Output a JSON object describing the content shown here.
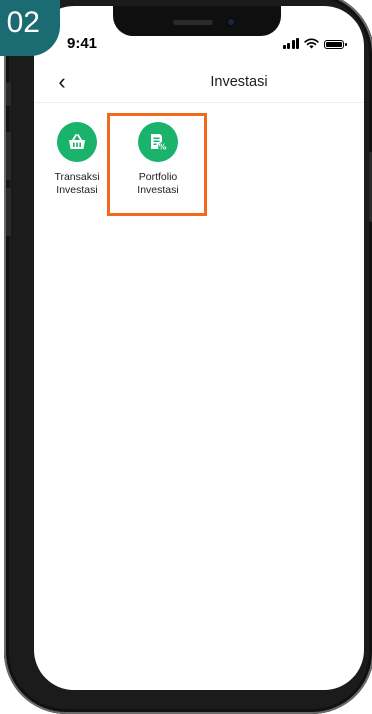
{
  "step_badge": "02",
  "status_bar": {
    "time": "9:41"
  },
  "header": {
    "back_glyph": "‹",
    "title": "Investasi"
  },
  "menu": [
    {
      "label_line1": "Transaksi",
      "label_line2": "Investasi",
      "icon": "shopping-basket-icon",
      "highlighted": false
    },
    {
      "label_line1": "Portfolio",
      "label_line2": "Investasi",
      "icon": "document-percent-icon",
      "highlighted": true
    }
  ],
  "colors": {
    "accent_green": "#1ab36b",
    "highlight_orange": "#f26b1d",
    "badge_teal": "#1b6b72"
  }
}
